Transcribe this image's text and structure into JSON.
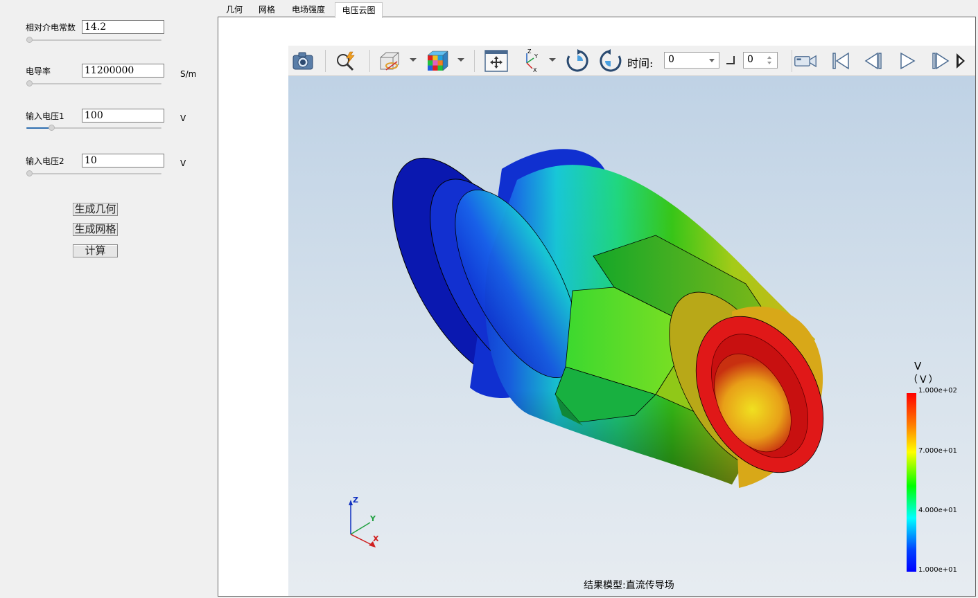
{
  "params": {
    "permittivity": {
      "label": "相对介电常数",
      "value": "14.2",
      "unit": "",
      "slider_level": 0.0
    },
    "conductivity": {
      "label": "电导率",
      "value": "11200000",
      "unit": "S/m",
      "slider_level": 0.0
    },
    "voltage1": {
      "label": "输入电压1",
      "value": "100",
      "unit": "V",
      "slider_level": 0.18
    },
    "voltage2": {
      "label": "输入电压2",
      "value": "10",
      "unit": "V",
      "slider_level": 0.0
    }
  },
  "actions": {
    "gen_geometry": "生成几何",
    "gen_mesh": "生成网格",
    "compute": "计算"
  },
  "tabs": [
    {
      "label": "几何"
    },
    {
      "label": "网格"
    },
    {
      "label": "电场强度"
    },
    {
      "label": "电压云图",
      "active": true
    }
  ],
  "toolbar": {
    "time_label": "时间:",
    "time_value": "0",
    "frame_value": "0"
  },
  "legend": {
    "title": "V",
    "unit": "（V）",
    "max": "1.000e+02",
    "tick_70": "7.000e+01",
    "tick_40": "4.000e+01",
    "min": "1.000e+01"
  },
  "axes": {
    "x": "X",
    "y": "Y",
    "z": "Z"
  },
  "footer": "结果模型:直流传导场"
}
